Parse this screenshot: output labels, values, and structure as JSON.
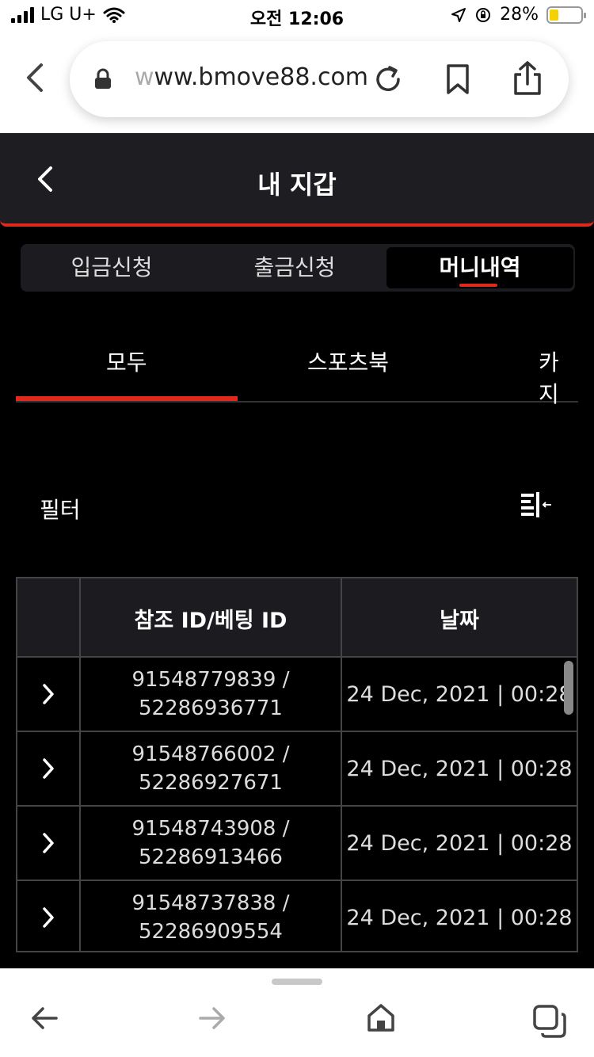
{
  "status": {
    "carrier": "LG U+",
    "time": "오전 12:06",
    "battery": "28%",
    "battery_level": 0.28
  },
  "browser": {
    "url_faded": "w",
    "url_main": "ww.bmove88.com"
  },
  "header": {
    "title": "내 지갑"
  },
  "tabs": [
    {
      "label": "입금신청"
    },
    {
      "label": "출금신청"
    },
    {
      "label": "머니내역"
    }
  ],
  "subtabs": [
    {
      "label": "모두"
    },
    {
      "label": "스포츠북"
    },
    {
      "label": "카지"
    }
  ],
  "filter": {
    "label": "필터"
  },
  "table": {
    "headers": [
      "참조 ID/베팅 ID",
      "날짜"
    ],
    "rows": [
      {
        "ref": "91548779839 /",
        "bet": "52286936771",
        "date": "24 Dec, 2021 | 00:28"
      },
      {
        "ref": "91548766002 /",
        "bet": "52286927671",
        "date": "24 Dec, 2021 | 00:28"
      },
      {
        "ref": "91548743908 /",
        "bet": "52286913466",
        "date": "24 Dec, 2021 | 00:28"
      },
      {
        "ref": "91548737838 /",
        "bet": "52286909554",
        "date": "24 Dec, 2021 | 00:28"
      }
    ]
  },
  "colors": {
    "accent": "#e0281c",
    "background": "#000000",
    "header_bg": "#1e1e22"
  }
}
